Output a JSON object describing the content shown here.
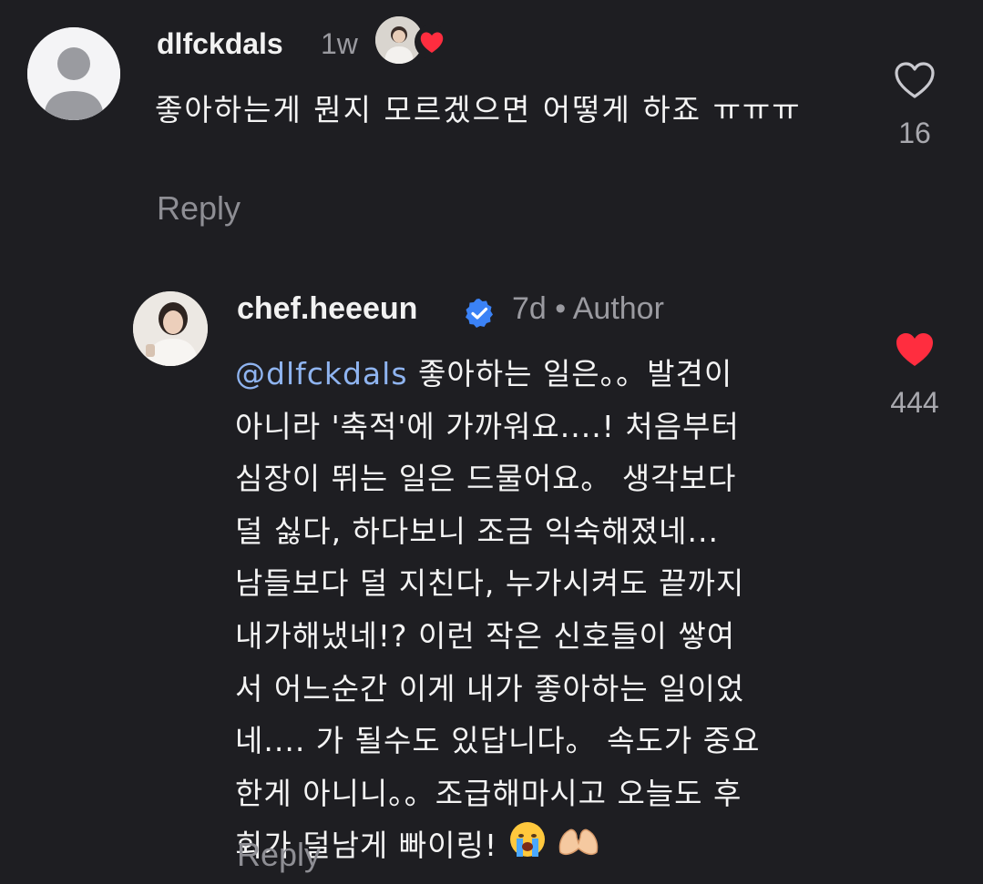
{
  "colors": {
    "background": "#1e1e22",
    "text_primary": "#f2f2f2",
    "text_secondary": "#9a9aa0",
    "mention": "#8fb4f0",
    "like_active": "#ff2d3f",
    "verified_badge": "#3b82f6"
  },
  "comments": [
    {
      "username": "dlfckdals",
      "time": "1w",
      "avatar_icon": "default-avatar-icon",
      "creator_liked_icon": "creator-liked-heart-icon",
      "text": "좋아하는게 뭔지 모르겠으면 어떻게 하죠 ㅠㅠㅠ",
      "reply_label": "Reply",
      "like_icon": "heart-outline-icon",
      "likes": "16"
    },
    {
      "username": "chef.heeeun",
      "verified_icon": "verified-badge-icon",
      "meta": "7d • Author",
      "mention": "@dlfckdals",
      "lines": [
        " 좋아하는 일은。。발견이",
        "아니라 '축적'에 가까워요....! 처음부터",
        "심장이 뛰는 일은 드물어요。 생각보다",
        "덜 싫다, 하다보니 조금 익숙해졌네...",
        "남들보다 덜 지친다, 누가시켜도 끝까지",
        "내가해냈네!? 이런 작은 신호들이 쌓여",
        "서 어느순간 이게 내가 좋아하는 일이었",
        "네.... 가 될수도 있답니다。 속도가 중요",
        "한게 아니니。。조급해마시고 오늘도 후",
        "회가 덜남게 빠이링!"
      ],
      "emojis": [
        "crying-face-icon",
        "heart-hands-icon"
      ],
      "reply_label": "Reply",
      "like_icon": "heart-filled-icon",
      "likes": "444"
    }
  ]
}
